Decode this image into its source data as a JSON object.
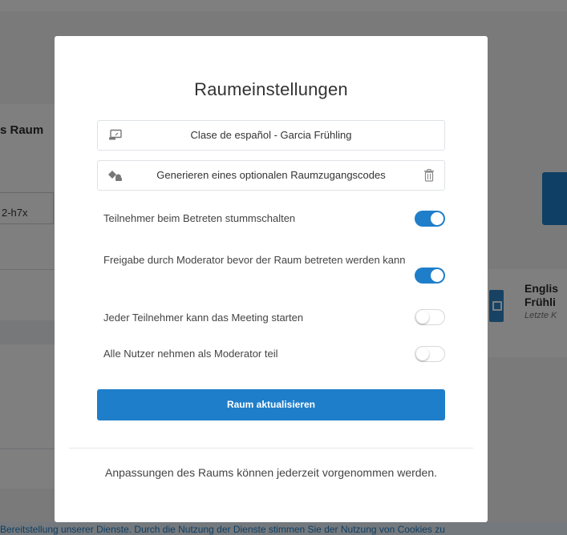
{
  "background_page": {
    "section_title_fragment": "s Raum",
    "access_code_fragment": "2-h7x",
    "room_card": {
      "name_line1": "Englis",
      "name_line2": "Frühli",
      "subtitle_fragment": "Letzte K"
    },
    "cookie_banner_fragment": "Bereitstellung unserer Dienste. Durch die Nutzung der Dienste stimmen Sie der Nutzung von Cookies zu"
  },
  "modal": {
    "title": "Raumeinstellungen",
    "room_name_value": "Clase de español - Garcia Frühling",
    "access_code_text": "Generieren eines optionalen Raumzugangscodes",
    "options": [
      {
        "label": "Teilnehmer beim Betreten stummschalten",
        "enabled": true
      },
      {
        "label": "Freigabe durch Moderator bevor der Raum betreten werden kann",
        "enabled": true
      },
      {
        "label": "Jeder Teilnehmer kann das Meeting starten",
        "enabled": false
      },
      {
        "label": "Alle Nutzer nehmen als Moderator teil",
        "enabled": false
      }
    ],
    "submit_label": "Raum aktualisieren",
    "footer_note": "Anpassungen des Raums können jederzeit vorgenommen werden."
  },
  "colors": {
    "accent": "#1f7ec9",
    "overlay": "rgba(0,0,0,0.5)"
  },
  "icons": [
    "room-name-icon",
    "key-icon",
    "trash-icon"
  ]
}
